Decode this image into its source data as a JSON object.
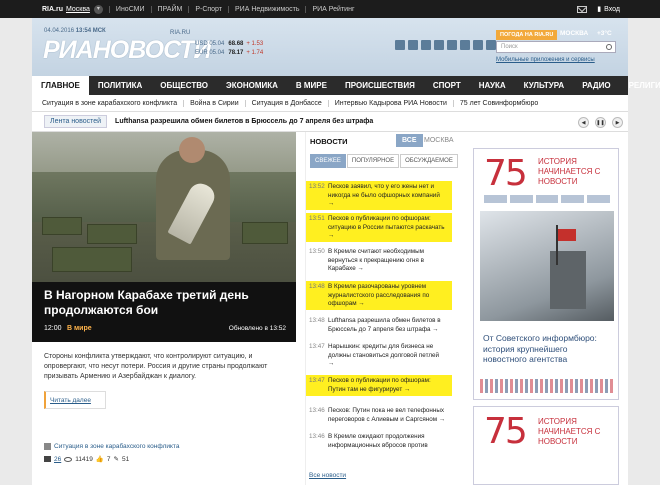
{
  "topbar": {
    "site": "RIA.ru",
    "city": "Москва",
    "links": [
      "ИноСМИ",
      "ПРАЙМ",
      "Р-Спорт",
      "РИА Недвижимость",
      "РИА Рейтинг"
    ],
    "login": "Вход"
  },
  "header": {
    "date": "04.04.2016",
    "time": "13:54 МСК",
    "logo": "РИАНОВОСТИ",
    "logo_domain": "RIA.RU",
    "rates": [
      {
        "name": "USD",
        "date": "05.04",
        "value": "68.68",
        "change": "+ 1.53"
      },
      {
        "name": "EUR",
        "date": "05.04",
        "value": "78.17",
        "change": "+ 1.74"
      }
    ],
    "weather_btn": "ПОГОДА НА RIA.RU",
    "weather_city": "МОСКВА",
    "weather_temp": "+3°C",
    "search_placeholder": "Поиск",
    "mobile_link": "Мобильные приложения и сервисы"
  },
  "nav": [
    "ГЛАВНОЕ",
    "ПОЛИТИКА",
    "ОБЩЕСТВО",
    "ЭКОНОМИКА",
    "В МИРЕ",
    "ПРОИСШЕСТВИЯ",
    "СПОРТ",
    "НАУКА",
    "КУЛЬТУРА",
    "РАДИО",
    "РЕЛИГИЯ"
  ],
  "subnav": [
    "Ситуация в зоне карабахского конфликта",
    "Война в Сирии",
    "Ситуация в Донбассе",
    "Интервью Кадырова РИА Новости",
    "75 лет Совинформбюро"
  ],
  "ticker": {
    "tab": "Лента новостей",
    "text": "Lufthansa разрешила обмен билетов в Брюссель до 7 апреля без штрафа"
  },
  "hero": {
    "title": "В Нагорном Карабахе третий день продолжаются бои",
    "time": "12:00",
    "section": "В мире",
    "updated": "Обновлено в 13:52",
    "lead": "Стороны конфликта утверждают, что контролируют ситуацию, и опровергают, что несут потери. Россия и другие страны продолжают призывать Армению и Азербайджан к диалогу.",
    "read_more": "Читать далее",
    "related": "Ситуация в зоне карабахского конфликта",
    "comments": "26",
    "views": "11419",
    "likes": "7",
    "shares": "51"
  },
  "news": {
    "title": "НОВОСТИ",
    "tab_all": "ВСЕ",
    "tab_moscow": "МОСКВА",
    "filters": [
      "СВЕЖЕЕ",
      "ПОПУЛЯРНОЕ",
      "ОБСУЖДАЕМОЕ"
    ],
    "items": [
      {
        "time": "13:52",
        "text": "Песков заявил, что у его жены нет и никогда не было офшорных компаний →"
      },
      {
        "time": "13:51",
        "text": "Песков о публикации по офшорам: ситуацию в России пытаются раскачать →"
      },
      {
        "time": "13:50",
        "text": "В Кремле считают необходимым вернуться к прекращению огня в Карабахе →"
      },
      {
        "time": "13:48",
        "text": "В Кремле разочарованы уровнем журналистского расследования по офшорам →"
      },
      {
        "time": "13:48",
        "text": "Lufthansa разрешила обмен билетов в Брюссель до 7 апреля без штрафа →"
      },
      {
        "time": "13:47",
        "text": "Нарышкин: кредиты для бизнеса не должны становиться долговой петлей →"
      },
      {
        "time": "13:47",
        "text": "Песков о публикации по офшорам: Путин там не фигурирует →"
      },
      {
        "time": "13:46",
        "text": "Песков: Путин пока не вел телефонных переговоров с Алиевым и Саргсяном →"
      },
      {
        "time": "13:46",
        "text": "В Кремле ожидают продолжения информационных вбросов против"
      }
    ],
    "all_link": "Все новости"
  },
  "ad": {
    "number": "75",
    "slogan": "ИСТОРИЯ НАЧИНАЕТСЯ С НОВОСТИ",
    "caption": "От Советского информбюро: история крупнейшего новостного агентства"
  },
  "ad2": {
    "number": "75",
    "slogan": "ИСТОРИЯ НАЧИНАЕТСЯ С НОВОСТИ"
  }
}
